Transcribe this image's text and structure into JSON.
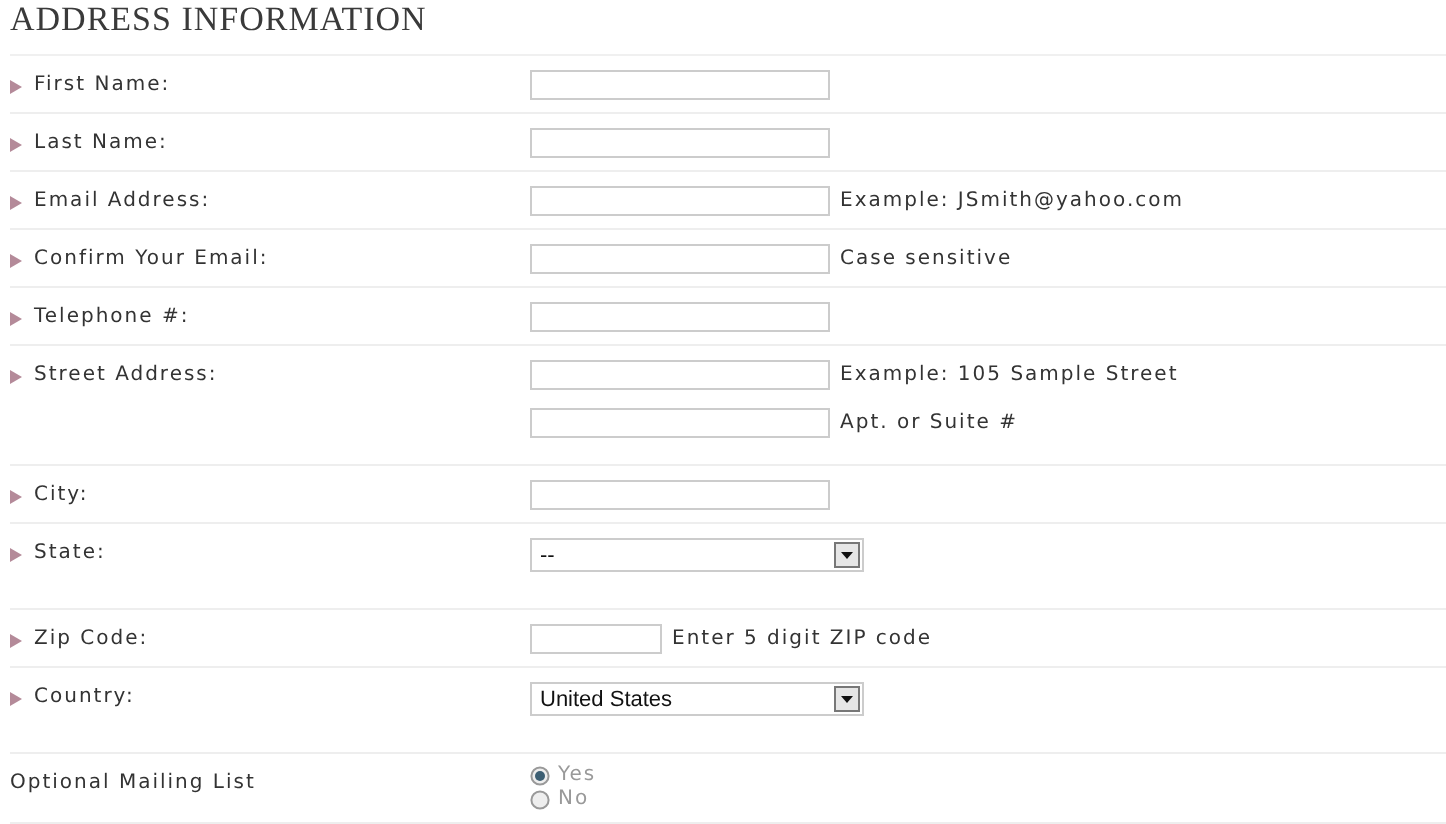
{
  "title": "ADDRESS INFORMATION",
  "fields": [
    {
      "kind": "text",
      "label": "First Name:",
      "required": true,
      "inputs": [
        {
          "short": false
        }
      ]
    },
    {
      "kind": "text",
      "label": "Last Name:",
      "required": true,
      "inputs": [
        {
          "short": false
        }
      ]
    },
    {
      "kind": "text",
      "label": "Email Address:",
      "required": true,
      "inputs": [
        {
          "short": false,
          "hint": "Example: JSmith@yahoo.com"
        }
      ]
    },
    {
      "kind": "text",
      "label": "Confirm Your Email:",
      "required": true,
      "inputs": [
        {
          "short": false,
          "hint": "Case sensitive"
        }
      ]
    },
    {
      "kind": "text",
      "label": "Telephone #:",
      "required": true,
      "inputs": [
        {
          "short": false
        }
      ]
    },
    {
      "kind": "text",
      "label": "Street Address:",
      "required": true,
      "inputs": [
        {
          "short": false,
          "hint": "Example: 105 Sample Street"
        },
        {
          "short": false,
          "hint": "Apt. or Suite #"
        }
      ]
    },
    {
      "kind": "text",
      "label": "City:",
      "required": true,
      "inputs": [
        {
          "short": false
        }
      ]
    },
    {
      "kind": "select",
      "label": "State:",
      "required": true,
      "value": "--"
    },
    {
      "kind": "text",
      "label": "Zip Code:",
      "required": true,
      "inputs": [
        {
          "short": true,
          "hint": "Enter 5 digit ZIP code"
        }
      ]
    },
    {
      "kind": "select",
      "label": "Country:",
      "required": true,
      "value": "United States"
    },
    {
      "kind": "radio",
      "label": "Optional Mailing List",
      "required": false,
      "options": [
        {
          "label": "Yes",
          "selected": true
        },
        {
          "label": "No",
          "selected": false
        }
      ]
    }
  ]
}
